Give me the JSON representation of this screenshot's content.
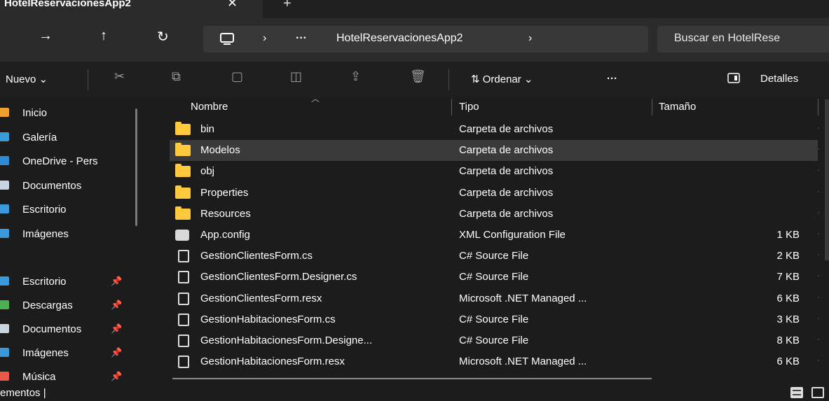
{
  "window": {
    "tab_title": "HotelReservacionesApp2",
    "tab_close": "✕",
    "tab_new": "+"
  },
  "nav": {
    "forward": "→",
    "up": "↑",
    "refresh": "↻",
    "sep": "›"
  },
  "breadcrumb": {
    "more": "···",
    "folder": "HotelReservacionesApp2"
  },
  "search": {
    "placeholder": "Buscar en HotelRese"
  },
  "commandbar": {
    "new_label": "Nuevo ⌄",
    "sort_label": "⇅ Ordenar ⌄",
    "more": "···",
    "details_label": "Detalles"
  },
  "sidebar": {
    "items": [
      {
        "label": "Inicio",
        "color": "#f0a030"
      },
      {
        "label": "Galería",
        "color": "#3a9ad9"
      },
      {
        "label": "OneDrive - Pers",
        "color": "#2f8ad6"
      },
      {
        "label": "Documentos",
        "color": "#c8d4e0"
      },
      {
        "label": "Escritorio",
        "color": "#3a9ad9"
      },
      {
        "label": "Imágenes",
        "color": "#3a9ad9"
      }
    ],
    "pinned": [
      {
        "label": "Escritorio",
        "color": "#3a9ad9"
      },
      {
        "label": "Descargas",
        "color": "#4caf50"
      },
      {
        "label": "Documentos",
        "color": "#c8d4e0"
      },
      {
        "label": "Imágenes",
        "color": "#3a9ad9"
      },
      {
        "label": "Música",
        "color": "#e8584a"
      }
    ]
  },
  "columns": {
    "name": "Nombre",
    "type": "Tipo",
    "size": "Tamaño"
  },
  "files": [
    {
      "name": "bin",
      "type": "Carpeta de archivos",
      "size": "",
      "icon": "folder",
      "selected": false
    },
    {
      "name": "Modelos",
      "type": "Carpeta de archivos",
      "size": "",
      "icon": "folder",
      "selected": true
    },
    {
      "name": "obj",
      "type": "Carpeta de archivos",
      "size": "",
      "icon": "folder",
      "selected": false
    },
    {
      "name": "Properties",
      "type": "Carpeta de archivos",
      "size": "",
      "icon": "folder",
      "selected": false
    },
    {
      "name": "Resources",
      "type": "Carpeta de archivos",
      "size": "",
      "icon": "folder",
      "selected": false
    },
    {
      "name": "App.config",
      "type": "XML Configuration File",
      "size": "1 KB",
      "icon": "config",
      "selected": false
    },
    {
      "name": "GestionClientesForm.cs",
      "type": "C# Source File",
      "size": "2 KB",
      "icon": "file",
      "selected": false
    },
    {
      "name": "GestionClientesForm.Designer.cs",
      "type": "C# Source File",
      "size": "7 KB",
      "icon": "file",
      "selected": false
    },
    {
      "name": "GestionClientesForm.resx",
      "type": "Microsoft .NET Managed ...",
      "size": "6 KB",
      "icon": "file",
      "selected": false
    },
    {
      "name": "GestionHabitacionesForm.cs",
      "type": "C# Source File",
      "size": "3 KB",
      "icon": "file",
      "selected": false
    },
    {
      "name": "GestionHabitacionesForm.Designe...",
      "type": "C# Source File",
      "size": "8 KB",
      "icon": "file",
      "selected": false
    },
    {
      "name": "GestionHabitacionesForm.resx",
      "type": "Microsoft .NET Managed ...",
      "size": "6 KB",
      "icon": "file",
      "selected": false
    }
  ],
  "status": {
    "text": "ementos  |"
  }
}
